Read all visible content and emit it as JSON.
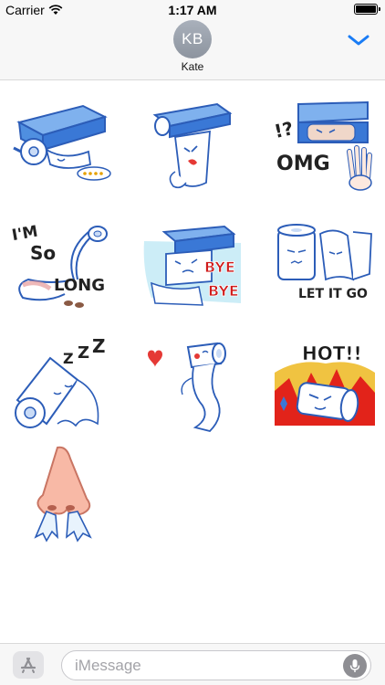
{
  "status_bar": {
    "carrier": "Carrier",
    "time": "1:17 AM",
    "battery_level": 1.0
  },
  "header": {
    "avatar_initials": "KB",
    "contact_name": "Kate"
  },
  "stickers": [
    {
      "label": "",
      "icon": "toilet-paper-dispenser-sticker"
    },
    {
      "label": "",
      "icon": "toilet-paper-pulled-sticker"
    },
    {
      "label": "!? OMG",
      "icon": "toilet-paper-omg-sticker"
    },
    {
      "label": "I'M SO LONG",
      "icon": "toilet-paper-so-long-sticker"
    },
    {
      "label": "BYE BYE",
      "icon": "toilet-paper-bye-bye-sticker"
    },
    {
      "label": "LET IT GO",
      "icon": "toilet-paper-let-it-go-sticker"
    },
    {
      "label": "ZZZ",
      "icon": "toilet-paper-sleeping-sticker"
    },
    {
      "label": "",
      "icon": "toilet-paper-kiss-sticker"
    },
    {
      "label": "HOT!!",
      "icon": "toilet-paper-hot-sticker"
    },
    {
      "label": "",
      "icon": "nose-tissue-sticker"
    }
  ],
  "input_bar": {
    "placeholder": "iMessage"
  },
  "colors": {
    "accent": "#1a7cf5",
    "paper_blue": "#3a6fd8",
    "avatar_gray": "#9aa1ac"
  }
}
